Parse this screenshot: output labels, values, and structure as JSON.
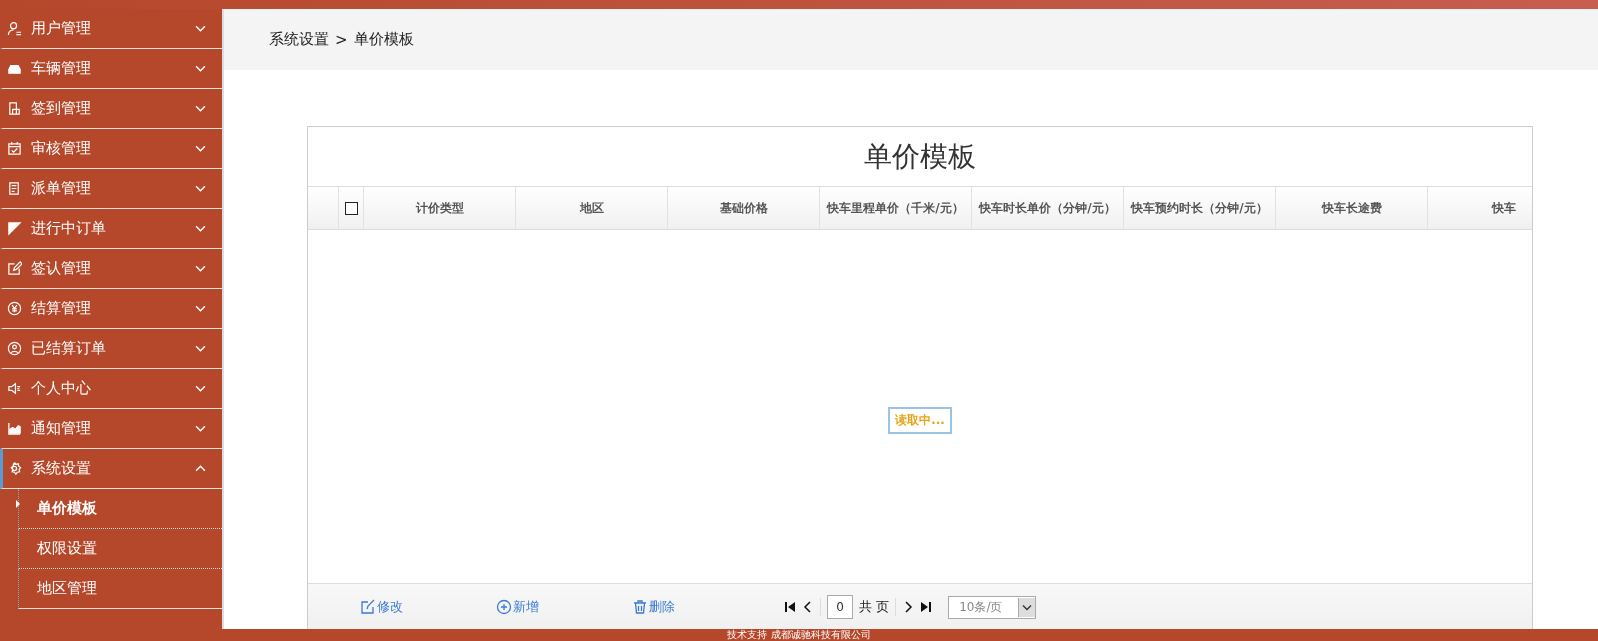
{
  "sidebar": {
    "items": [
      {
        "label": "用户管理",
        "expanded": false
      },
      {
        "label": "车辆管理",
        "expanded": false
      },
      {
        "label": "签到管理",
        "expanded": false
      },
      {
        "label": "审核管理",
        "expanded": false
      },
      {
        "label": "派单管理",
        "expanded": false
      },
      {
        "label": "进行中订单",
        "expanded": false
      },
      {
        "label": "签认管理",
        "expanded": false
      },
      {
        "label": "结算管理",
        "expanded": false
      },
      {
        "label": "已结算订单",
        "expanded": false
      },
      {
        "label": "个人中心",
        "expanded": false
      },
      {
        "label": "通知管理",
        "expanded": false
      },
      {
        "label": "系统设置",
        "expanded": true,
        "children": [
          {
            "label": "单价模板",
            "selected": true
          },
          {
            "label": "权限设置",
            "selected": false
          },
          {
            "label": "地区管理",
            "selected": false
          }
        ]
      }
    ]
  },
  "breadcrumb": {
    "items": [
      "系统设置",
      "单价模板"
    ],
    "separator": ">"
  },
  "panel": {
    "title": "单价模板",
    "table": {
      "columns": [
        "计价类型",
        "地区",
        "基础价格",
        "快车里程单价（千米/元）",
        "快车时长单价（分钟/元）",
        "快车预约时长（分钟/元）",
        "快车长途费",
        "快车"
      ],
      "select_all": {
        "checked": false
      }
    },
    "loading": "读取中...",
    "actions": [
      "修改",
      "新增",
      "删除"
    ],
    "pager": {
      "page": "0",
      "total_label": "共 页",
      "page_size": "10条/页"
    }
  },
  "footer": "技术支持 成都诚驰科技有限公司"
}
